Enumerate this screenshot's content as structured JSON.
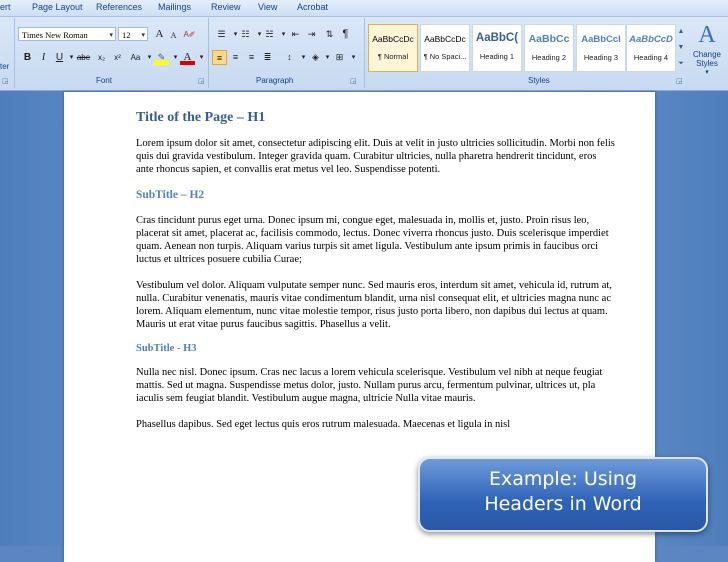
{
  "tabs": [
    "ert",
    "Page Layout",
    "References",
    "Mailings",
    "Review",
    "View",
    "Acrobat"
  ],
  "font": {
    "name": "Times New Roman",
    "size": "12",
    "group_label": "Font"
  },
  "paragraph": {
    "group_label": "Paragraph"
  },
  "styles": {
    "group_label": "Styles",
    "items": [
      {
        "sample": "AaBbCcDc",
        "name": "¶ Normal"
      },
      {
        "sample": "AaBbCcDc",
        "name": "¶ No Spaci..."
      },
      {
        "sample": "AaBbC(",
        "name": "Heading 1"
      },
      {
        "sample": "AaBbCc",
        "name": "Heading 2"
      },
      {
        "sample": "AaBbCcI",
        "name": "Heading 3"
      },
      {
        "sample": "AaBbCcD",
        "name": "Heading 4"
      }
    ],
    "change_styles": "Change Styles"
  },
  "left_edge": {
    "top": "ter",
    "bottom": "r"
  },
  "icons": {
    "bold": "B",
    "italic": "I",
    "underline": "U",
    "strikethrough": "abe",
    "subscript": "x₂",
    "superscript": "x²",
    "clear": "Aa",
    "grow": "A",
    "shrink": "A"
  },
  "document": {
    "title": "Title of the Page – H1",
    "p1": "Lorem ipsum dolor sit amet, consectetur adipiscing elit. Duis at velit in justo ultricies sollicitudin. Morbi non felis quis dui gravida vestibulum. Integer gravida quam. Curabitur ultricies, nulla pharetra hendrerit tincidunt, eros ante rhoncus sapien, et convallis erat metus vel leo. Suspendisse potenti.",
    "subtitle_h2": "SubTitle – H2",
    "p2": "Cras tincidunt purus eget urna. Donec ipsum mi, congue eget, malesuada in, mollis et, justo. Proin risus leo, placerat sit amet, placerat ac, facilisis commodo, lectus. Donec viverra rhoncus justo. Duis scelerisque imperdiet quam. Aenean non turpis. Aliquam varius turpis sit amet ligula. Vestibulum ante ipsum primis in faucibus orci luctus et ultrices posuere cubilia Curae;",
    "p3": "Vestibulum vel dolor. Aliquam vulputate semper nunc. Sed mauris eros, interdum sit amet, vehicula id, rutrum at, nulla. Curabitur venenatis, mauris vitae condimentum blandit, urna nisl consequat elit, et ultricies magna nunc ac lorem. Aliquam elementum, nunc vitae molestie tempor, risus justo porta libero, non dapibus dui lectus at quam. Mauris ut erat vitae purus faucibus sagittis. Phasellus a velit.",
    "subtitle_h3": "SubTitle - H3",
    "p4": "Nulla nec nisl. Donec ipsum. Cras nec lacus a lorem vehicula scelerisque. Vestibulum vel nibh at neque feugiat mattis. Sed ut magna. Suspendisse metus dolor, justo. Nullam purus arcu, fermentum pulvinar, ultrices ut, pla iaculis sem feugiat blandit. Vestibulum augue magna, ultricie Nulla vitae mauris.",
    "p5": "Phasellus dapibus. Sed eget lectus quis eros rutrum malesuada. Maecenas et ligula in nisl"
  },
  "callout": {
    "line1": "Example: Using",
    "line2": "Headers in Word"
  },
  "colors": {
    "heading1": "#365f91",
    "heading2": "#4f81bd",
    "ribbon": "#c7daf1",
    "callout": "#2f63b8"
  }
}
